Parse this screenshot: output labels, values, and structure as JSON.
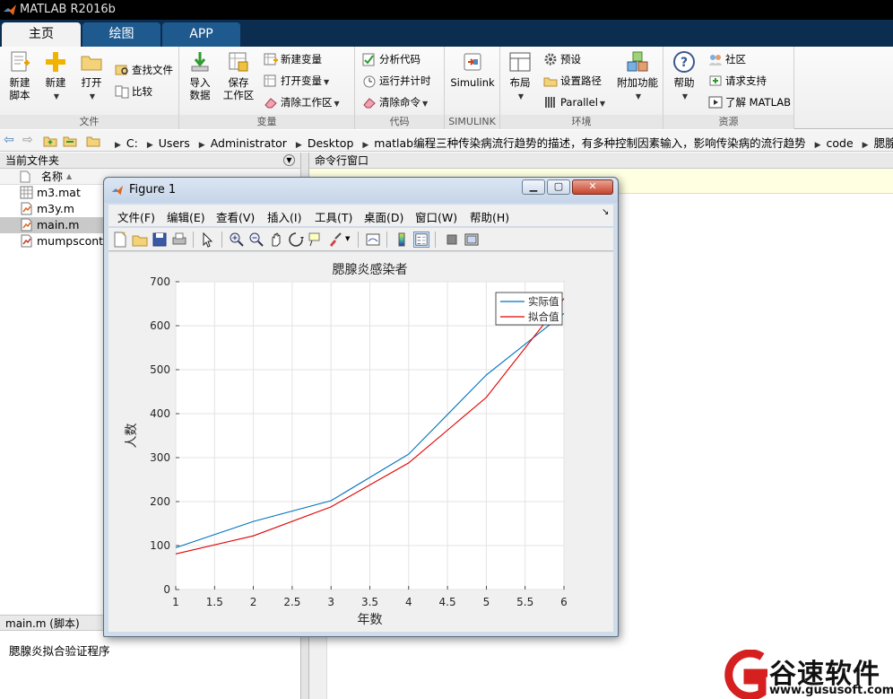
{
  "app": {
    "title": "MATLAB R2016b"
  },
  "tabs": [
    {
      "label": "主页",
      "active": true
    },
    {
      "label": "绘图",
      "active": false
    },
    {
      "label": "APP",
      "active": false
    }
  ],
  "ribbon": {
    "file": {
      "section_label": "文件",
      "new_script": "新建\n脚本",
      "new": "新建",
      "open": "打开",
      "find_files": "查找文件",
      "compare": "比较"
    },
    "variable": {
      "section_label": "变量",
      "import": "导入\n数据",
      "save_ws": "保存\n工作区",
      "new_var": "新建变量",
      "open_var": "打开变量",
      "clear_ws": "清除工作区"
    },
    "code": {
      "section_label": "代码",
      "analyze": "分析代码",
      "run_time": "运行并计时",
      "clear_cmd": "清除命令"
    },
    "simulink": {
      "section_label": "SIMULINK",
      "simulink": "Simulink"
    },
    "environment": {
      "section_label": "环境",
      "layout": "布局",
      "prefs": "预设",
      "set_path": "设置路径",
      "parallel": "Parallel",
      "addons": "附加功能"
    },
    "resources": {
      "section_label": "资源",
      "help": "帮助",
      "community": "社区",
      "support": "请求支持",
      "learn": "了解 MATLAB"
    }
  },
  "address": {
    "crumbs": [
      "C:",
      "Users",
      "Administrator",
      "Desktop",
      "matlab编程三种传染病流行趋势的描述，有多种控制因素输入，影响传染病的流行趋势",
      "code",
      "腮腺炎程序"
    ]
  },
  "left_pane": {
    "title": "当前文件夹",
    "column_name": "名称",
    "files": [
      {
        "name": "m3.mat",
        "icon": "mat-file-icon",
        "selected": false
      },
      {
        "name": "m3y.m",
        "icon": "m-file-icon",
        "selected": false
      },
      {
        "name": "main.m",
        "icon": "m-file-icon",
        "selected": true
      },
      {
        "name": "mumpscontr",
        "icon": "mlx-file-icon",
        "selected": false
      }
    ],
    "details_title": "main.m  (脚本)",
    "details_text": "腮腺炎拟合验证程序"
  },
  "right_pane": {
    "title": "命令行窗口"
  },
  "figure": {
    "title": "Figure 1",
    "menu": [
      "文件(F)",
      "编辑(E)",
      "查看(V)",
      "插入(I)",
      "工具(T)",
      "桌面(D)",
      "窗口(W)",
      "帮助(H)"
    ]
  },
  "chart_data": {
    "type": "line",
    "title": "腮腺炎感染者",
    "xlabel": "年数",
    "ylabel": "人数",
    "xlim": [
      1,
      6
    ],
    "ylim": [
      0,
      700
    ],
    "xticks": [
      "1",
      "1.5",
      "2",
      "2.5",
      "3",
      "3.5",
      "4",
      "4.5",
      "5",
      "5.5",
      "6"
    ],
    "yticks": [
      "0",
      "100",
      "200",
      "300",
      "400",
      "500",
      "600",
      "700"
    ],
    "grid": true,
    "legend_position": "top-right",
    "x": [
      1,
      2,
      3,
      4,
      5,
      6
    ],
    "series": [
      {
        "name": "实际值",
        "color": "#0072bd",
        "values": [
          95,
          155,
          202,
          308,
          488,
          628
        ]
      },
      {
        "name": "拟合值",
        "color": "#e00000",
        "values": [
          81,
          122,
          188,
          288,
          437,
          662
        ]
      }
    ]
  },
  "watermark": {
    "text": "谷速软件",
    "url": "www.gususoft.com"
  }
}
